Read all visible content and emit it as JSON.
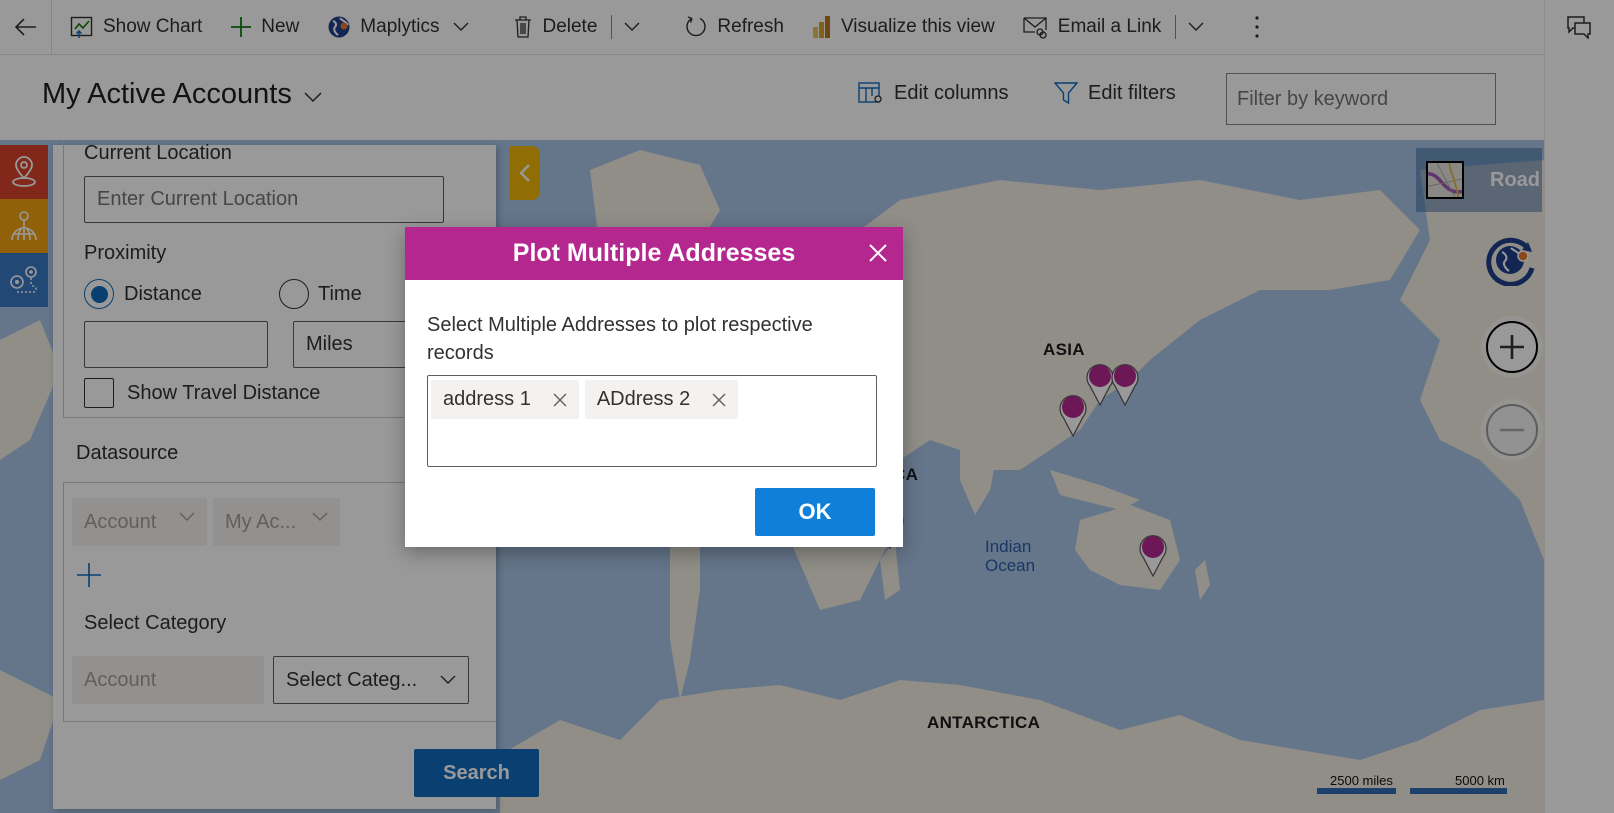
{
  "command_bar": {
    "back_icon": "arrow-left",
    "items": [
      {
        "label": "Show Chart",
        "icon": "chart-icon"
      },
      {
        "label": "New",
        "icon": "plus-icon"
      },
      {
        "label": "Maplytics",
        "icon": "maplytics-globe-icon",
        "has_dropdown": true
      },
      {
        "label": "Delete",
        "icon": "trash-icon",
        "has_split_dropdown": true
      },
      {
        "label": "Refresh",
        "icon": "refresh-icon"
      },
      {
        "label": "Visualize this view",
        "icon": "power-bi-icon"
      },
      {
        "label": "Email a Link",
        "icon": "email-link-icon",
        "has_split_dropdown": true
      }
    ],
    "more_icon": "more-vertical",
    "side_icon": "chat-icon"
  },
  "view_header": {
    "title": "My Active Accounts",
    "edit_columns": "Edit columns",
    "edit_filters": "Edit filters",
    "filter_placeholder": "Filter by keyword"
  },
  "left_panel": {
    "current_location_label": "Current Location",
    "current_location_placeholder": "Enter Current Location",
    "proximity_label": "Proximity",
    "radio_distance": "Distance",
    "radio_time": "Time",
    "selected_proximity": "Distance",
    "distance_value": "",
    "unit_value": "Miles",
    "show_travel_distance": "Show Travel Distance",
    "show_travel_distance_checked": false,
    "datasource_label": "Datasource",
    "datasource_entity": "Account",
    "datasource_view": "My Ac...",
    "select_category_label": "Select Category",
    "category_entity": "Account",
    "category_select": "Select Categ...",
    "search_button": "Search"
  },
  "side_strip": {
    "icons": [
      "location-pin-icon",
      "territory-globe-icon",
      "route-pins-icon"
    ],
    "colors": [
      "#c0392b",
      "#e08e0b",
      "#2e6db4"
    ]
  },
  "map": {
    "labels": {
      "asia": "ASIA",
      "africa": "ICA",
      "antarctica": "ANTARCTICA",
      "indian_ocean_1": "Indian",
      "indian_ocean_2": "Ocean"
    },
    "road_button": "Road",
    "scale_miles": "2500 miles",
    "scale_km": "5000 km",
    "pin_color": "#b4278f",
    "pin_count": 5
  },
  "dialog": {
    "title": "Plot Multiple Addresses",
    "description": "Select Multiple Addresses to plot respective records",
    "tags": [
      "address 1",
      "ADdress 2"
    ],
    "ok_button": "OK",
    "header_color": "#b4278f"
  }
}
